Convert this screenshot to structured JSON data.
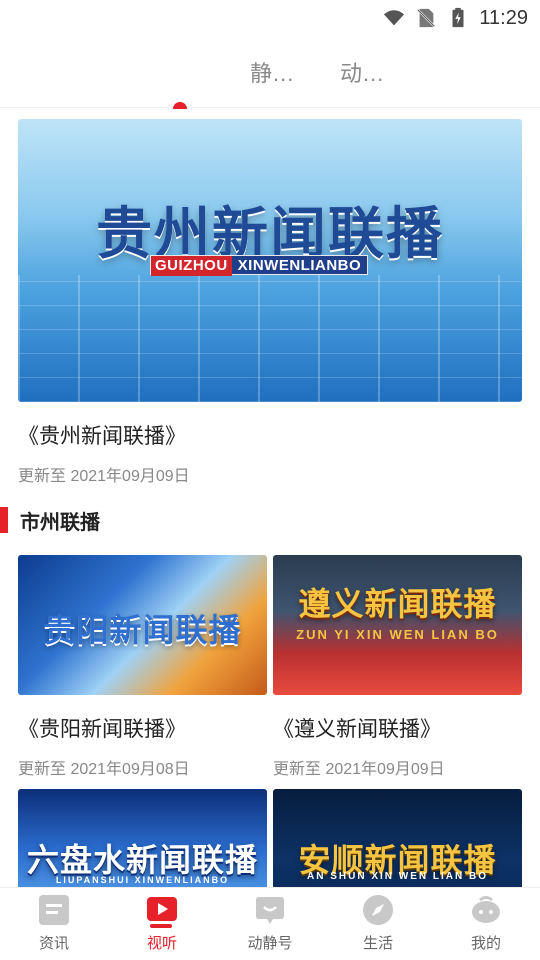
{
  "status_bar": {
    "time": "11:29",
    "icons": [
      "wifi-icon",
      "no-sim-icon",
      "battery-charging-icon"
    ]
  },
  "top_tabs": [
    {
      "label": "静...",
      "active": true
    },
    {
      "label": "动...",
      "active": false
    }
  ],
  "featured": {
    "logo_text": "贵州新闻联播",
    "logo_sub_red": "GUIZHOU",
    "logo_sub": "XINWENLIANBO",
    "title": "《贵州新闻联播》",
    "date": "更新至 2021年09月09日"
  },
  "section": {
    "title": "市州联播"
  },
  "cards": [
    {
      "logo_text": "贵阳新闻联播",
      "logo_sub": "",
      "title": "《贵阳新闻联播》",
      "date": "更新至 2021年09月08日"
    },
    {
      "logo_text": "遵义新闻联播",
      "logo_sub": "ZUN YI XIN WEN LIAN BO",
      "title": "《遵义新闻联播》",
      "date": "更新至 2021年09月09日"
    },
    {
      "logo_text": "六盘水新闻联播",
      "logo_sub": "LIUPANSHUI XINWENLIANBO",
      "title": "",
      "date": ""
    },
    {
      "logo_text": "安顺新闻联播",
      "logo_sub": "AN SHUN XIN WEN LIAN BO",
      "title": "",
      "date": ""
    }
  ],
  "bottom_nav": [
    {
      "label": "资讯",
      "icon": "news-icon",
      "active": false
    },
    {
      "label": "视听",
      "icon": "play-icon",
      "active": true
    },
    {
      "label": "动静号",
      "icon": "chat-icon",
      "active": false
    },
    {
      "label": "生活",
      "icon": "compass-icon",
      "active": false
    },
    {
      "label": "我的",
      "icon": "profile-icon",
      "active": false
    }
  ],
  "colors": {
    "accent": "#e62129",
    "text": "#222222",
    "muted": "#888888"
  }
}
